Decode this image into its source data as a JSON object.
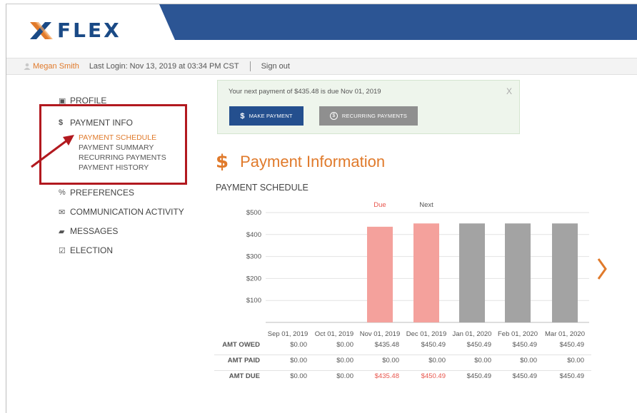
{
  "app": {
    "logo_text": "FLEX",
    "brand_color": "#2c5594",
    "accent_color": "#e07a2b"
  },
  "userbar": {
    "user_name": "Megan Smith",
    "last_login": "Last Login: Nov 13, 2019 at 03:34 PM CST",
    "signout": "Sign out"
  },
  "sidebar": {
    "items": [
      {
        "icon": "profile-icon",
        "label": "PROFILE"
      },
      {
        "icon": "dollar-icon",
        "label": "PAYMENT INFO"
      },
      {
        "icon": "percent-icon",
        "label": "PREFERENCES"
      },
      {
        "icon": "mail-icon",
        "label": "COMMUNICATION ACTIVITY"
      },
      {
        "icon": "chat-icon",
        "label": "MESSAGES"
      },
      {
        "icon": "checkbox-icon",
        "label": "ELECTION"
      }
    ],
    "payment_subitems": [
      "PAYMENT SCHEDULE",
      "PAYMENT SUMMARY",
      "RECURRING PAYMENTS",
      "PAYMENT HISTORY"
    ],
    "active_subitem": "PAYMENT SCHEDULE",
    "highlight_color": "#b2191f"
  },
  "notice": {
    "text": "Your next payment of $435.48 is due Nov 01, 2019",
    "close": "X",
    "make_payment": "MAKE PAYMENT",
    "recurring_payments": "RECURRING PAYMENTS"
  },
  "main": {
    "title": "Payment Information",
    "subtitle": "PAYMENT SCHEDULE",
    "next_glyph": "›"
  },
  "chart_data": {
    "type": "bar",
    "categories": [
      "Sep 01, 2019",
      "Oct 01, 2019",
      "Nov 01, 2019",
      "Dec 01, 2019",
      "Jan 01, 2020",
      "Feb 01, 2020",
      "Mar 01, 2020"
    ],
    "values": [
      0,
      0,
      435.48,
      450.49,
      450.49,
      450.49,
      450.49
    ],
    "bar_colors": [
      "#f4a19c",
      "#f4a19c",
      "#f4a19c",
      "#f4a19c",
      "#a3a3a3",
      "#a3a3a3",
      "#a3a3a3"
    ],
    "markers": [
      {
        "category": "Nov 01, 2019",
        "label": "Due",
        "color": "#e8564d"
      },
      {
        "category": "Dec 01, 2019",
        "label": "Next",
        "color": "#555555"
      }
    ],
    "y_ticks": [
      "$100",
      "$200",
      "$300",
      "$400",
      "$500"
    ],
    "ylim": [
      0,
      500
    ],
    "grid": true
  },
  "table": {
    "rows": [
      {
        "label": "AMT OWED",
        "values": [
          "$0.00",
          "$0.00",
          "$435.48",
          "$450.49",
          "$450.49",
          "$450.49",
          "$450.49"
        ]
      },
      {
        "label": "AMT PAID",
        "values": [
          "$0.00",
          "$0.00",
          "$0.00",
          "$0.00",
          "$0.00",
          "$0.00",
          "$0.00"
        ]
      },
      {
        "label": "AMT DUE",
        "values": [
          "$0.00",
          "$0.00",
          "$435.48",
          "$450.49",
          "$450.49",
          "$450.49",
          "$450.49"
        ]
      }
    ],
    "due_highlight_color": "#e8564d"
  }
}
